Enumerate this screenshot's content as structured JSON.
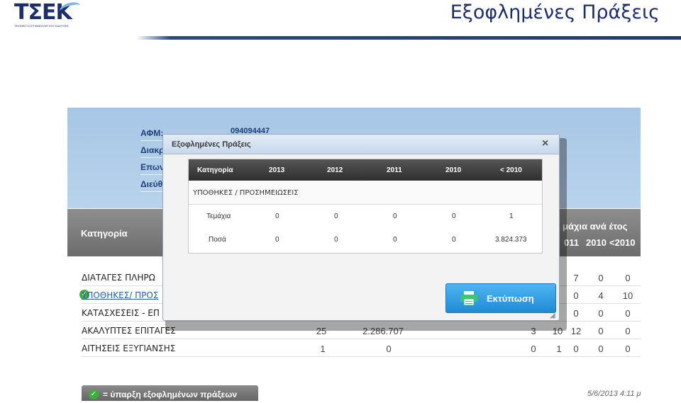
{
  "header": {
    "logo_text": "ΤΣΕΚ",
    "logo_tagline": "ΤΕΧΝΙΚΟ ΣΥΣΤΗΜΑ ΕΛΕΓΧΟΥ ΚΑΛΥΨΗΣ",
    "slide_title": "Εξοφλημένες Πράξεις"
  },
  "background_page": {
    "info_labels": [
      "ΑΦΜ:",
      "Διακρ",
      "Επων",
      "Διεύθ"
    ],
    "afm_value": "094094447",
    "table_header": {
      "category": "Κατηγορία",
      "years_caption": "μάχια ανά έτος",
      "year_cols": [
        "011",
        "2010",
        "<2010"
      ]
    },
    "rows": [
      {
        "name": "ΔΙΑΤΑΓΕΣ ΠΛΗΡΩ",
        "link": false,
        "checked": false,
        "a": "",
        "b": "",
        "c": "",
        "d": "7",
        "e": "0",
        "f": "0"
      },
      {
        "name": "ΥΠΟΘΗΚΕΣ/ ΠΡΟΣ",
        "link": true,
        "checked": true,
        "a": "",
        "b": "",
        "c": "",
        "d": "0",
        "e": "4",
        "f": "10"
      },
      {
        "name": "ΚΑΤΑΣΧΕΣΕΙΣ - ΕΠ",
        "link": false,
        "checked": false,
        "a": "",
        "b": "",
        "c": "",
        "d": "0",
        "e": "0",
        "f": "0"
      },
      {
        "name": "ΑΚΑΛΥΠΤΕΣ ΕΠΙΤΑΓΕΣ",
        "link": false,
        "checked": false,
        "a": "25",
        "b": "2.286.707",
        "c": "3",
        "c2": "10",
        "d": "12",
        "e": "0",
        "f": "0"
      },
      {
        "name": "ΑΙΤΗΣΕΙΣ ΕΞΥΓΙΑΝΣΗΣ",
        "link": false,
        "checked": false,
        "a": "1",
        "b": "0",
        "c": "0",
        "c2": "1",
        "d": "0",
        "e": "0",
        "f": "0"
      }
    ],
    "legend_label": "= ύπαρξη εξοφλημένων πράξεων",
    "timestamp": "5/6/2013 4:11 μ"
  },
  "modal": {
    "title": "Εξοφλημένες Πράξεις",
    "columns": [
      "Κατηγορία",
      "2013",
      "2012",
      "2011",
      "2010",
      "< 2010"
    ],
    "section": "ΥΠΟΘΗΚΕΣ / ΠΡΟΣΗΜΕΙΩΣΕΙΣ",
    "rows": [
      {
        "label": "Τεμάχια",
        "values": [
          "0",
          "0",
          "0",
          "0",
          "1"
        ]
      },
      {
        "label": "Ποσά",
        "values": [
          "0",
          "0",
          "0",
          "0",
          "3.824.373"
        ]
      }
    ],
    "print_label": "Εκτύπωση"
  },
  "colors": {
    "brand_navy": "#1d2e6b",
    "top_panel_blue": "#b0cce8",
    "print_button_blue": "#2b9ae0",
    "check_green": "#3dae3d"
  }
}
